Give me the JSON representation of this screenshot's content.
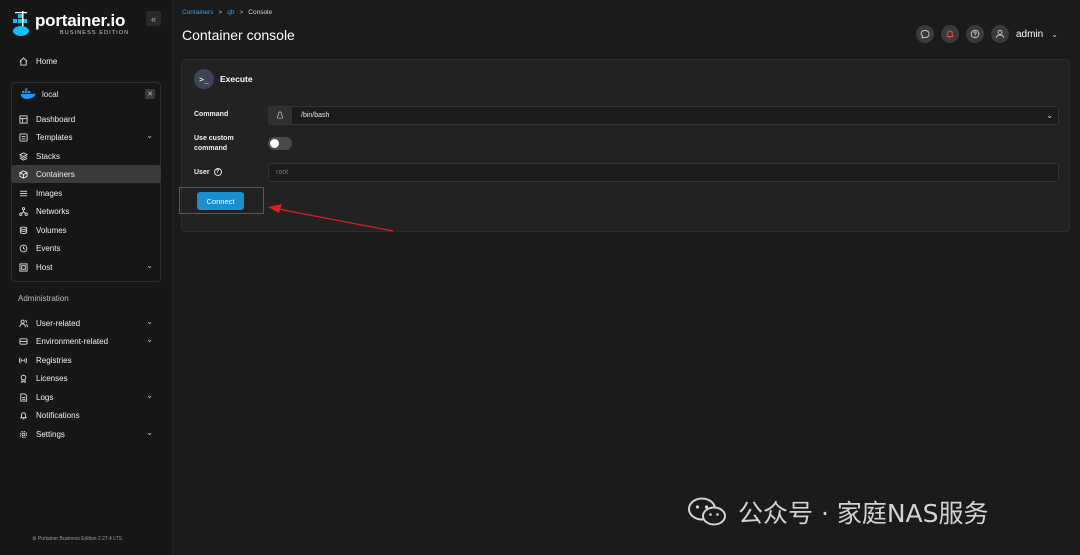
{
  "app": {
    "brand": "portainer.io",
    "edition": "BUSINESS EDITION",
    "footer": "Portainer Business Edition 2.27.4 LTS"
  },
  "sidebar": {
    "home": "Home",
    "environment": {
      "name": "local",
      "items": [
        {
          "label": "Dashboard",
          "icon": "dashboard-icon"
        },
        {
          "label": "Templates",
          "icon": "templates-icon",
          "expandable": true
        },
        {
          "label": "Stacks",
          "icon": "stacks-icon"
        },
        {
          "label": "Containers",
          "icon": "containers-icon",
          "active": true
        },
        {
          "label": "Images",
          "icon": "images-icon"
        },
        {
          "label": "Networks",
          "icon": "networks-icon"
        },
        {
          "label": "Volumes",
          "icon": "volumes-icon"
        },
        {
          "label": "Events",
          "icon": "events-icon"
        },
        {
          "label": "Host",
          "icon": "host-icon",
          "expandable": true
        }
      ]
    },
    "admin_title": "Administration",
    "admin_items": [
      {
        "label": "User-related",
        "icon": "users-icon",
        "expandable": true
      },
      {
        "label": "Environment-related",
        "icon": "environment-icon",
        "expandable": true
      },
      {
        "label": "Registries",
        "icon": "registries-icon"
      },
      {
        "label": "Licenses",
        "icon": "licenses-icon"
      },
      {
        "label": "Logs",
        "icon": "logs-icon",
        "expandable": true
      },
      {
        "label": "Notifications",
        "icon": "notifications-icon"
      },
      {
        "label": "Settings",
        "icon": "settings-icon",
        "expandable": true
      }
    ]
  },
  "breadcrumb": {
    "containers": "Containers",
    "container": "qb",
    "current": "Console"
  },
  "header": {
    "title": "Container console",
    "user": "admin"
  },
  "panel": {
    "title": "Execute",
    "command_label": "Command",
    "command_value": "/bin/bash",
    "custom_label": "Use custom command",
    "custom_enabled": false,
    "user_label": "User",
    "user_placeholder": "root",
    "connect_label": "Connect"
  },
  "watermark": "公众号 · 家庭NAS服务",
  "colors": {
    "accent": "#1a8ed1",
    "link": "#3ea0e6",
    "highlight": "#e01f1f",
    "background": "#1b1b1b"
  }
}
